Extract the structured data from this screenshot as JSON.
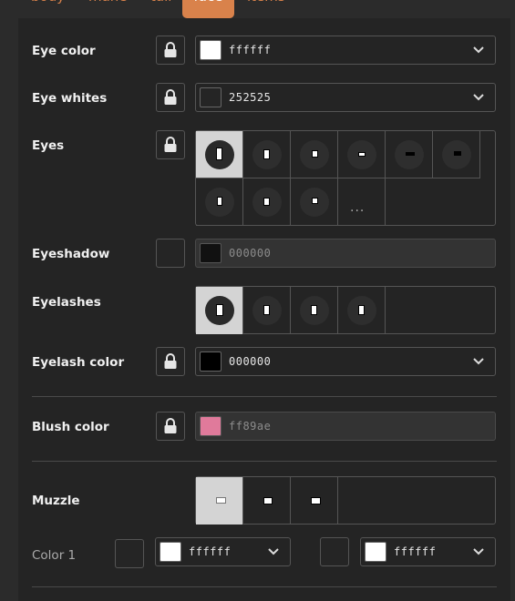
{
  "tabs": [
    {
      "label": "body",
      "active": false
    },
    {
      "label": "mane",
      "active": false
    },
    {
      "label": "tail",
      "active": false
    },
    {
      "label": "face",
      "active": true
    },
    {
      "label": "items",
      "active": false
    }
  ],
  "rows": {
    "eye_color": {
      "label": "Eye color",
      "value": "ffffff",
      "swatch": "#ffffff",
      "locked_button": true
    },
    "eye_whites": {
      "label": "Eye whites",
      "value": "252525",
      "swatch": "#252525",
      "locked_button": true
    },
    "eyes": {
      "label": "Eyes",
      "more_label": "..."
    },
    "eyeshadow": {
      "label": "Eyeshadow",
      "value": "000000",
      "swatch": "#111111",
      "disabled": true
    },
    "eyelashes": {
      "label": "Eyelashes"
    },
    "eyelash_color": {
      "label": "Eyelash color",
      "value": "000000",
      "swatch": "#000000"
    },
    "blush_color": {
      "label": "Blush color",
      "value": "ff89ae",
      "swatch": "#e07a9b",
      "disabled": true
    },
    "muzzle": {
      "label": "Muzzle"
    },
    "color1": {
      "label": "Color 1",
      "left_value": "ffffff",
      "right_value": "ffffff",
      "swatch": "#ffffff"
    }
  },
  "colors": {
    "accent": "#d9824b",
    "panel": "#242424",
    "selected_cell": "#d4d4d4"
  }
}
